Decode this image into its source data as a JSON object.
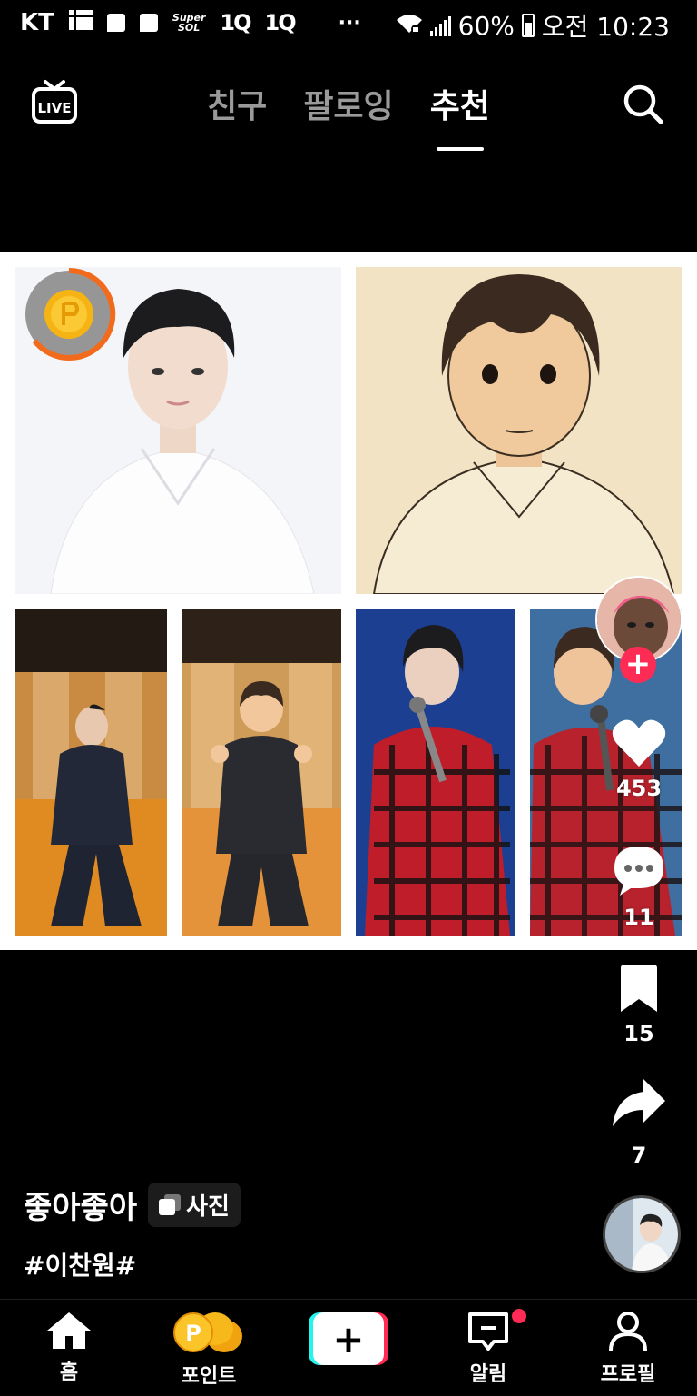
{
  "status_bar": {
    "carrier": "KT",
    "super_label": "Super",
    "sol_label": "SOL",
    "app_badge_1": "1Q",
    "app_badge_2": "1Q",
    "more": "···",
    "battery": "60%",
    "time": "오전 10:23"
  },
  "header": {
    "live_label": "LIVE",
    "tabs": [
      "친구",
      "팔로잉",
      "추천"
    ],
    "active_tab": "추천"
  },
  "post": {
    "likes": "453",
    "comments": "11",
    "saves": "15",
    "shares": "7",
    "username": "좋아좋아",
    "media_type": "사진",
    "hashtags": "#이찬원#"
  },
  "bottom_nav": {
    "items": [
      "홈",
      "포인트",
      "알림",
      "프로필"
    ],
    "create_symbol": "+"
  },
  "colors": {
    "accent": "#fe2c55",
    "create_left": "#25f4ee",
    "create_right": "#fe2c55",
    "coin_ring": "#f26b1d"
  },
  "icons": [
    "live-icon",
    "search-icon",
    "coin-icon",
    "plus-icon",
    "heart-icon",
    "comment-icon",
    "bookmark-icon",
    "share-icon",
    "home-icon",
    "points-icon",
    "notification-icon",
    "profile-icon"
  ]
}
